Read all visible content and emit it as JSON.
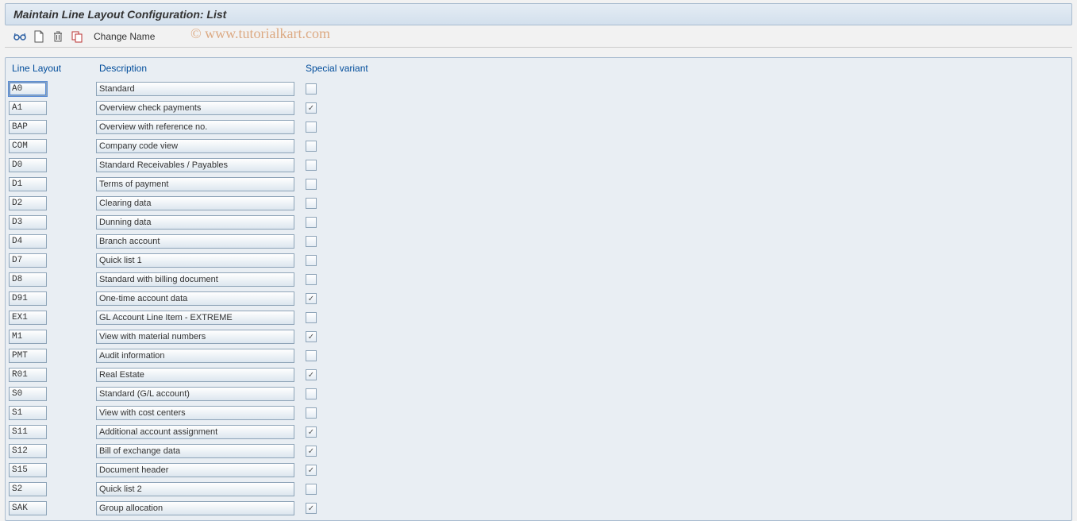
{
  "title": "Maintain Line Layout Configuration: List",
  "toolbar": {
    "change_name": "Change Name"
  },
  "watermark": "© www.tutorialkart.com",
  "columns": {
    "line_layout": "Line Layout",
    "description": "Description",
    "special_variant": "Special variant"
  },
  "rows": [
    {
      "code": "A0",
      "description": "Standard",
      "special": false,
      "focused": true
    },
    {
      "code": "A1",
      "description": "Overview check payments",
      "special": true
    },
    {
      "code": "BAP",
      "description": "Overview with reference no.",
      "special": false
    },
    {
      "code": "COM",
      "description": "Company code view",
      "special": false
    },
    {
      "code": "D0",
      "description": "Standard Receivables / Payables",
      "special": false
    },
    {
      "code": "D1",
      "description": "Terms of payment",
      "special": false
    },
    {
      "code": "D2",
      "description": "Clearing data",
      "special": false
    },
    {
      "code": "D3",
      "description": "Dunning data",
      "special": false
    },
    {
      "code": "D4",
      "description": "Branch account",
      "special": false
    },
    {
      "code": "D7",
      "description": "Quick list 1",
      "special": false
    },
    {
      "code": "D8",
      "description": "Standard with billing document",
      "special": false
    },
    {
      "code": "D91",
      "description": "One-time account data",
      "special": true
    },
    {
      "code": "EX1",
      "description": "GL Account Line Item - EXTREME",
      "special": false
    },
    {
      "code": "M1",
      "description": "View with material numbers",
      "special": true
    },
    {
      "code": "PMT",
      "description": "Audit information",
      "special": false
    },
    {
      "code": "R01",
      "description": "Real Estate",
      "special": true
    },
    {
      "code": "S0",
      "description": "Standard (G/L account)",
      "special": false
    },
    {
      "code": "S1",
      "description": "View with cost centers",
      "special": false
    },
    {
      "code": "S11",
      "description": "Additional account assignment",
      "special": true
    },
    {
      "code": "S12",
      "description": "Bill of exchange data",
      "special": true
    },
    {
      "code": "S15",
      "description": "Document header",
      "special": true
    },
    {
      "code": "S2",
      "description": "Quick list 2",
      "special": false
    },
    {
      "code": "SAK",
      "description": "Group allocation",
      "special": true
    }
  ]
}
